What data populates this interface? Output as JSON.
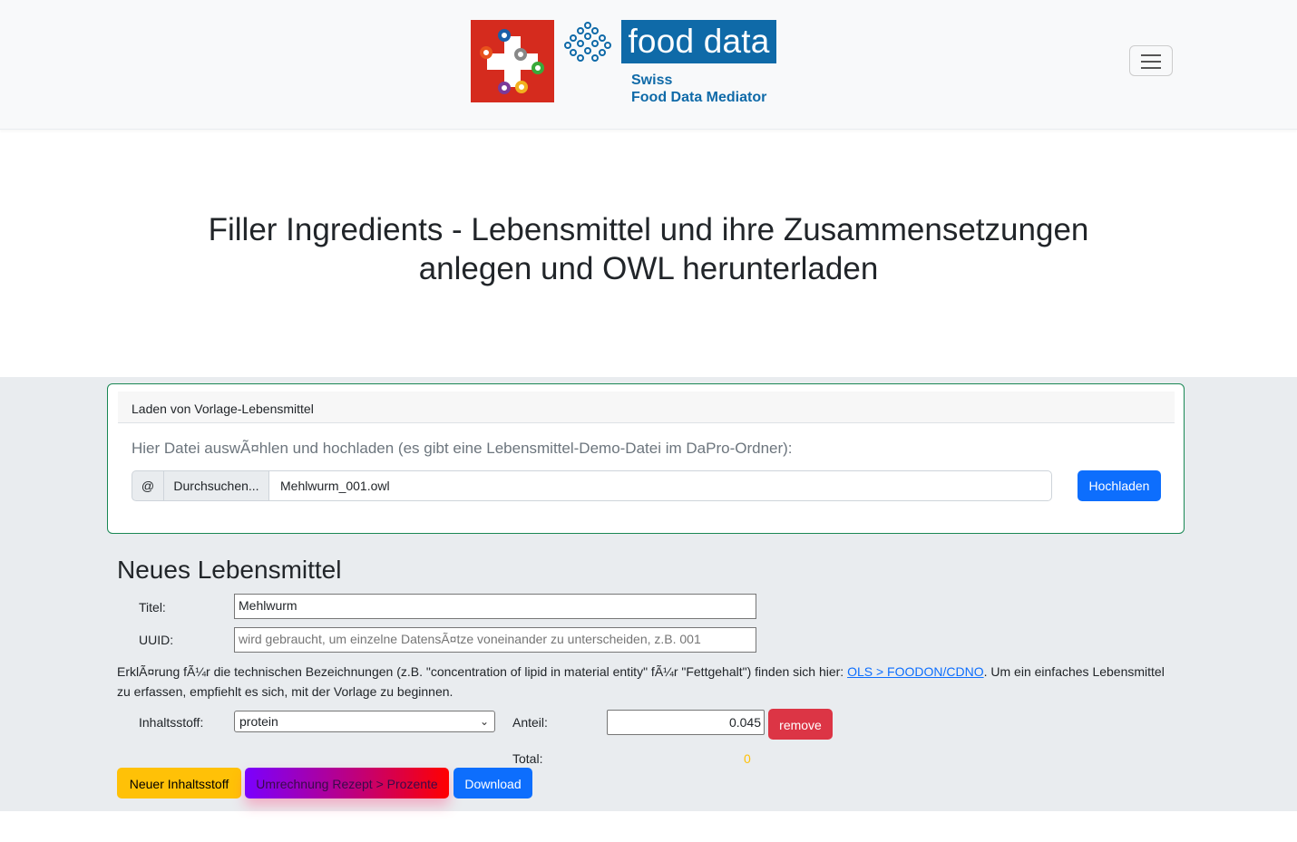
{
  "header": {
    "brand_text": "food data",
    "brand_sub_line1": "Swiss",
    "brand_sub_line2": "Food Data Mediator"
  },
  "hero": {
    "title_line1": "Filler Ingredients - Lebensmittel und ihre Zusammensetzungen",
    "title_line2": "anlegen und OWL herunterladen"
  },
  "upload_card": {
    "header": "Laden von Vorlage-Lebensmittel",
    "instruction": "Hier Datei auswÃ¤hlen und hochladen (es gibt eine Lebensmittel-Demo-Datei im DaPro-Ordner):",
    "prefix": "@",
    "browse_label": "Durchsuchen...",
    "file_name": "Mehlwurm_001.owl",
    "upload_button": "Hochladen"
  },
  "form": {
    "heading": "Neues Lebensmittel",
    "title_label": "Titel:",
    "title_value": "Mehlwurm",
    "uuid_label": "UUID:",
    "uuid_placeholder": "wird gebraucht, um einzelne DatensÃ¤tze voneinander zu unterscheiden, z.B. 001",
    "help_text_before": "ErklÃ¤rung fÃ¼r die technischen Bezeichnungen (z.B. \"concentration of lipid in material entity\" fÃ¼r \"Fettgehalt\") finden sich hier: ",
    "help_link": "OLS > FOODON/CDNO",
    "help_text_after": ". Um ein einfaches Lebensmittel zu erfassen, empfiehlt es sich, mit der Vorlage zu beginnen.",
    "ingredient_label": "Inhaltsstoff:",
    "ingredient_selected": "protein",
    "share_label": "Anteil:",
    "share_value": "0.045",
    "remove_button": "remove",
    "total_label": "Total:",
    "total_value": "0",
    "new_ingredient_button": "Neuer Inhaltsstoff",
    "convert_button": "Umrechnung Rezept > Prozente",
    "download_button": "Download"
  },
  "colors": {
    "brand_blue": "#0f6aa8",
    "swiss_red": "#d52b1e",
    "primary": "#0d6efd",
    "danger": "#dc3545",
    "warning": "#ffc107",
    "success_border": "#198754"
  }
}
